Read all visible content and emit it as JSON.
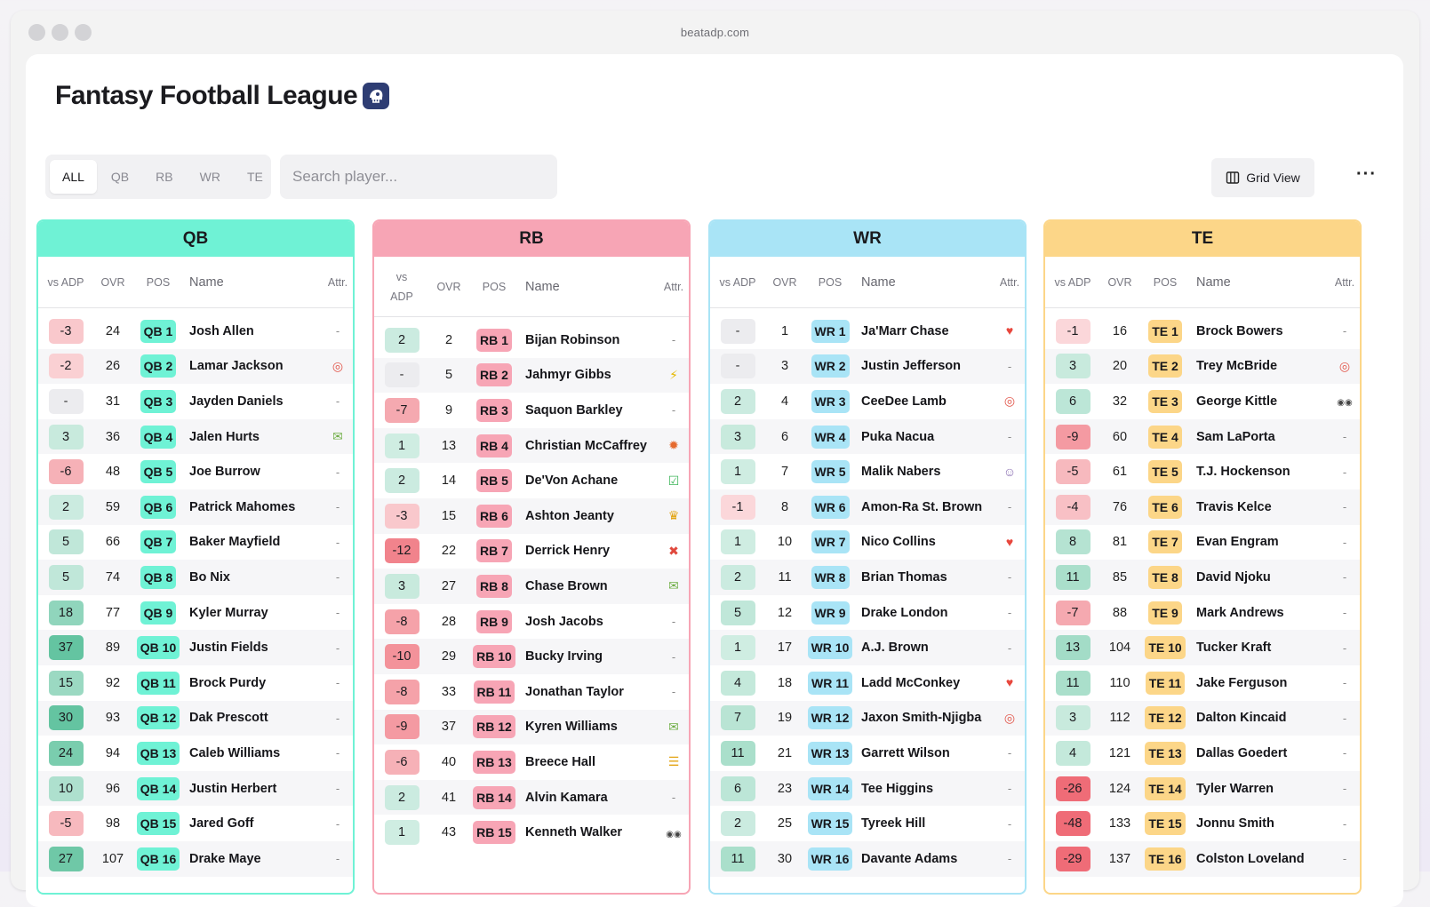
{
  "browser": {
    "url": "beatadp.com"
  },
  "header": {
    "title": "Fantasy Football League",
    "logo_icon": "football-helmet-icon"
  },
  "filters": {
    "tabs": [
      "ALL",
      "QB",
      "RB",
      "WR",
      "TE"
    ],
    "active": "ALL"
  },
  "search": {
    "placeholder": "Search player..."
  },
  "view": {
    "grid_label": "Grid View",
    "more_label": "···"
  },
  "table_headers": {
    "adp": "vs ADP",
    "ovr": "OVR",
    "pos": "POS",
    "name": "Name",
    "attr": "Attr."
  },
  "colors": {
    "qb": "#6ff2d5",
    "rb": "#f7a5b5",
    "wr": "#a9e4f6",
    "te": "#fcd688",
    "qb_border": "#6ff2d5",
    "rb_border": "#f7a5b5",
    "wr_border": "#a9e4f6",
    "te_border": "#fcd688"
  },
  "columns": [
    {
      "key": "qb",
      "title": "QB",
      "players": [
        {
          "adp": "-3",
          "ovr": "24",
          "pos": "QB 1",
          "name": "Josh Allen",
          "attr": "-"
        },
        {
          "adp": "-2",
          "ovr": "26",
          "pos": "QB 2",
          "name": "Lamar Jackson",
          "attr": "target-icon"
        },
        {
          "adp": "-",
          "ovr": "31",
          "pos": "QB 3",
          "name": "Jayden Daniels",
          "attr": "-"
        },
        {
          "adp": "3",
          "ovr": "36",
          "pos": "QB 4",
          "name": "Jalen Hurts",
          "attr": "money-icon"
        },
        {
          "adp": "-6",
          "ovr": "48",
          "pos": "QB 5",
          "name": "Joe Burrow",
          "attr": "-"
        },
        {
          "adp": "2",
          "ovr": "59",
          "pos": "QB 6",
          "name": "Patrick Mahomes",
          "attr": "-"
        },
        {
          "adp": "5",
          "ovr": "66",
          "pos": "QB 7",
          "name": "Baker Mayfield",
          "attr": "-"
        },
        {
          "adp": "5",
          "ovr": "74",
          "pos": "QB 8",
          "name": "Bo Nix",
          "attr": "-"
        },
        {
          "adp": "18",
          "ovr": "77",
          "pos": "QB 9",
          "name": "Kyler Murray",
          "attr": "-"
        },
        {
          "adp": "37",
          "ovr": "89",
          "pos": "QB 10",
          "name": "Justin Fields",
          "attr": "-"
        },
        {
          "adp": "15",
          "ovr": "92",
          "pos": "QB 11",
          "name": "Brock Purdy",
          "attr": "-"
        },
        {
          "adp": "30",
          "ovr": "93",
          "pos": "QB 12",
          "name": "Dak Prescott",
          "attr": "-"
        },
        {
          "adp": "24",
          "ovr": "94",
          "pos": "QB 13",
          "name": "Caleb Williams",
          "attr": "-"
        },
        {
          "adp": "10",
          "ovr": "96",
          "pos": "QB 14",
          "name": "Justin Herbert",
          "attr": "-"
        },
        {
          "adp": "-5",
          "ovr": "98",
          "pos": "QB 15",
          "name": "Jared Goff",
          "attr": "-"
        },
        {
          "adp": "27",
          "ovr": "107",
          "pos": "QB 16",
          "name": "Drake Maye",
          "attr": "-"
        }
      ]
    },
    {
      "key": "rb",
      "title": "RB",
      "players": [
        {
          "adp": "2",
          "ovr": "2",
          "pos": "RB 1",
          "name": "Bijan Robinson",
          "attr": "-"
        },
        {
          "adp": "-",
          "ovr": "5",
          "pos": "RB 2",
          "name": "Jahmyr Gibbs",
          "attr": "lightning-icon"
        },
        {
          "adp": "-7",
          "ovr": "9",
          "pos": "RB 3",
          "name": "Saquon Barkley",
          "attr": "-"
        },
        {
          "adp": "1",
          "ovr": "13",
          "pos": "RB 4",
          "name": "Christian McCaffrey",
          "attr": "siren-icon"
        },
        {
          "adp": "2",
          "ovr": "14",
          "pos": "RB 5",
          "name": "De'Von Achane",
          "attr": "check-icon"
        },
        {
          "adp": "-3",
          "ovr": "15",
          "pos": "RB 6",
          "name": "Ashton Jeanty",
          "attr": "crown-icon"
        },
        {
          "adp": "-12",
          "ovr": "22",
          "pos": "RB 7",
          "name": "Derrick Henry",
          "attr": "cross-icon"
        },
        {
          "adp": "3",
          "ovr": "27",
          "pos": "RB 8",
          "name": "Chase Brown",
          "attr": "money-icon"
        },
        {
          "adp": "-8",
          "ovr": "28",
          "pos": "RB 9",
          "name": "Josh Jacobs",
          "attr": "-"
        },
        {
          "adp": "-10",
          "ovr": "29",
          "pos": "RB 10",
          "name": "Bucky Irving",
          "attr": "-"
        },
        {
          "adp": "-8",
          "ovr": "33",
          "pos": "RB 11",
          "name": "Jonathan Taylor",
          "attr": "-"
        },
        {
          "adp": "-9",
          "ovr": "37",
          "pos": "RB 12",
          "name": "Kyren Williams",
          "attr": "money-icon"
        },
        {
          "adp": "-6",
          "ovr": "40",
          "pos": "RB 13",
          "name": "Breece Hall",
          "attr": "barrier-icon"
        },
        {
          "adp": "2",
          "ovr": "41",
          "pos": "RB 14",
          "name": "Alvin Kamara",
          "attr": "-"
        },
        {
          "adp": "1",
          "ovr": "43",
          "pos": "RB 15",
          "name": "Kenneth Walker",
          "attr": "eyes-icon"
        }
      ]
    },
    {
      "key": "wr",
      "title": "WR",
      "players": [
        {
          "adp": "-",
          "ovr": "1",
          "pos": "WR 1",
          "name": "Ja'Marr Chase",
          "attr": "heart-icon"
        },
        {
          "adp": "-",
          "ovr": "3",
          "pos": "WR 2",
          "name": "Justin Jefferson",
          "attr": "-"
        },
        {
          "adp": "2",
          "ovr": "4",
          "pos": "WR 3",
          "name": "CeeDee Lamb",
          "attr": "target-icon"
        },
        {
          "adp": "3",
          "ovr": "6",
          "pos": "WR 4",
          "name": "Puka Nacua",
          "attr": "-"
        },
        {
          "adp": "1",
          "ovr": "7",
          "pos": "WR 5",
          "name": "Malik Nabers",
          "attr": "baby-icon"
        },
        {
          "adp": "-1",
          "ovr": "8",
          "pos": "WR 6",
          "name": "Amon-Ra St. Brown",
          "attr": "-"
        },
        {
          "adp": "1",
          "ovr": "10",
          "pos": "WR 7",
          "name": "Nico Collins",
          "attr": "heart-icon"
        },
        {
          "adp": "2",
          "ovr": "11",
          "pos": "WR 8",
          "name": "Brian Thomas",
          "attr": "-"
        },
        {
          "adp": "5",
          "ovr": "12",
          "pos": "WR 9",
          "name": "Drake London",
          "attr": "-"
        },
        {
          "adp": "1",
          "ovr": "17",
          "pos": "WR 10",
          "name": "A.J. Brown",
          "attr": "-"
        },
        {
          "adp": "4",
          "ovr": "18",
          "pos": "WR 11",
          "name": "Ladd McConkey",
          "attr": "heart-icon"
        },
        {
          "adp": "7",
          "ovr": "19",
          "pos": "WR 12",
          "name": "Jaxon Smith-Njigba",
          "attr": "target-icon"
        },
        {
          "adp": "11",
          "ovr": "21",
          "pos": "WR 13",
          "name": "Garrett Wilson",
          "attr": "-"
        },
        {
          "adp": "6",
          "ovr": "23",
          "pos": "WR 14",
          "name": "Tee Higgins",
          "attr": "-"
        },
        {
          "adp": "2",
          "ovr": "25",
          "pos": "WR 15",
          "name": "Tyreek Hill",
          "attr": "-"
        },
        {
          "adp": "11",
          "ovr": "30",
          "pos": "WR 16",
          "name": "Davante Adams",
          "attr": "-"
        }
      ]
    },
    {
      "key": "te",
      "title": "TE",
      "players": [
        {
          "adp": "-1",
          "ovr": "16",
          "pos": "TE 1",
          "name": "Brock Bowers",
          "attr": "-"
        },
        {
          "adp": "3",
          "ovr": "20",
          "pos": "TE 2",
          "name": "Trey McBride",
          "attr": "target-icon"
        },
        {
          "adp": "6",
          "ovr": "32",
          "pos": "TE 3",
          "name": "George Kittle",
          "attr": "eyes-icon"
        },
        {
          "adp": "-9",
          "ovr": "60",
          "pos": "TE 4",
          "name": "Sam LaPorta",
          "attr": "-"
        },
        {
          "adp": "-5",
          "ovr": "61",
          "pos": "TE 5",
          "name": "T.J. Hockenson",
          "attr": "-"
        },
        {
          "adp": "-4",
          "ovr": "76",
          "pos": "TE 6",
          "name": "Travis Kelce",
          "attr": "-"
        },
        {
          "adp": "8",
          "ovr": "81",
          "pos": "TE 7",
          "name": "Evan Engram",
          "attr": "-"
        },
        {
          "adp": "11",
          "ovr": "85",
          "pos": "TE 8",
          "name": "David Njoku",
          "attr": "-"
        },
        {
          "adp": "-7",
          "ovr": "88",
          "pos": "TE 9",
          "name": "Mark Andrews",
          "attr": "-"
        },
        {
          "adp": "13",
          "ovr": "104",
          "pos": "TE 10",
          "name": "Tucker Kraft",
          "attr": "-"
        },
        {
          "adp": "11",
          "ovr": "110",
          "pos": "TE 11",
          "name": "Jake Ferguson",
          "attr": "-"
        },
        {
          "adp": "3",
          "ovr": "112",
          "pos": "TE 12",
          "name": "Dalton Kincaid",
          "attr": "-"
        },
        {
          "adp": "4",
          "ovr": "121",
          "pos": "TE 13",
          "name": "Dallas Goedert",
          "attr": "-"
        },
        {
          "adp": "-26",
          "ovr": "124",
          "pos": "TE 14",
          "name": "Tyler Warren",
          "attr": "-"
        },
        {
          "adp": "-48",
          "ovr": "133",
          "pos": "TE 15",
          "name": "Jonnu Smith",
          "attr": "-"
        },
        {
          "adp": "-29",
          "ovr": "137",
          "pos": "TE 16",
          "name": "Colston Loveland",
          "attr": "-"
        }
      ]
    }
  ]
}
